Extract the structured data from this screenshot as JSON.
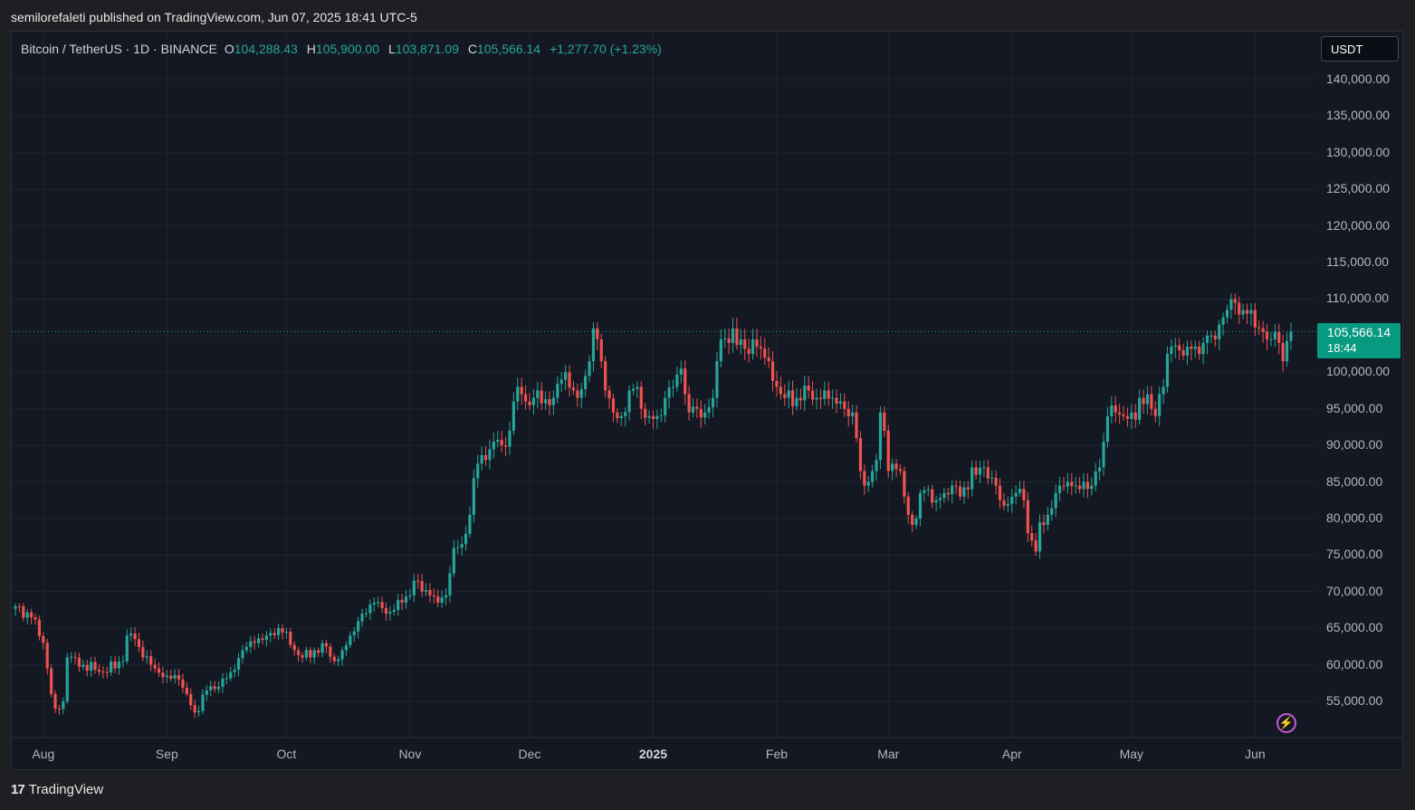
{
  "header": {
    "publisher_line": "semilorefaleti published on TradingView.com, Jun 07, 2025 18:41 UTC-5"
  },
  "legend": {
    "symbol": "Bitcoin / TetherUS · 1D · BINANCE",
    "open_label": "O",
    "open": "104,288.43",
    "high_label": "H",
    "high": "105,900.00",
    "low_label": "L",
    "low": "103,871.09",
    "close_label": "C",
    "close": "105,566.14",
    "change": "+1,277.70 (+1.23%)"
  },
  "currency_button": "USDT",
  "price_tag": {
    "price": "105,566.14",
    "countdown": "18:44"
  },
  "footer": {
    "logo_text": "TradingView",
    "logo_mark": "17"
  },
  "colors": {
    "up": "#26a69a",
    "down": "#ef5350",
    "background": "#141823",
    "grid": "#1f2430"
  },
  "icons": {
    "alert": "lightning-bolt-icon"
  },
  "chart_data": {
    "type": "candlestick",
    "title": "Bitcoin / TetherUS · 1D · BINANCE",
    "ylim": [
      51000,
      144000
    ],
    "grid": true,
    "y_ticks": [
      "140,000.00",
      "135,000.00",
      "130,000.00",
      "125,000.00",
      "120,000.00",
      "115,000.00",
      "110,000.00",
      "105,000.00",
      "100,000.00",
      "95,000.00",
      "90,000.00",
      "85,000.00",
      "80,000.00",
      "75,000.00",
      "70,000.00",
      "65,000.00",
      "60,000.00",
      "55,000.00"
    ],
    "y_tick_values": [
      140000,
      135000,
      130000,
      125000,
      120000,
      115000,
      110000,
      105000,
      100000,
      95000,
      90000,
      85000,
      80000,
      75000,
      70000,
      65000,
      60000,
      55000
    ],
    "x_ticks": [
      {
        "label": "Aug",
        "day": 7
      },
      {
        "label": "Sep",
        "day": 38
      },
      {
        "label": "Oct",
        "day": 68
      },
      {
        "label": "Nov",
        "day": 99
      },
      {
        "label": "Dec",
        "day": 129
      },
      {
        "label": "2025",
        "day": 160,
        "bold": true
      },
      {
        "label": "Feb",
        "day": 191
      },
      {
        "label": "Mar",
        "day": 219
      },
      {
        "label": "Apr",
        "day": 250
      },
      {
        "label": "May",
        "day": 280
      },
      {
        "label": "Jun",
        "day": 311
      }
    ],
    "last_price": 105566.14,
    "anchors": [
      [
        0,
        68000
      ],
      [
        4,
        66500
      ],
      [
        7,
        63000
      ],
      [
        9,
        56000
      ],
      [
        10,
        54000
      ],
      [
        12,
        55000
      ],
      [
        13,
        61000
      ],
      [
        17,
        60000
      ],
      [
        22,
        59000
      ],
      [
        27,
        60500
      ],
      [
        28,
        64000
      ],
      [
        30,
        63500
      ],
      [
        32,
        61000
      ],
      [
        35,
        59500
      ],
      [
        38,
        58500
      ],
      [
        41,
        58000
      ],
      [
        44,
        54500
      ],
      [
        45,
        53500
      ],
      [
        48,
        56500
      ],
      [
        51,
        57000
      ],
      [
        54,
        59000
      ],
      [
        57,
        62000
      ],
      [
        60,
        63000
      ],
      [
        63,
        64000
      ],
      [
        66,
        65000
      ],
      [
        68,
        64500
      ],
      [
        70,
        62000
      ],
      [
        72,
        61000
      ],
      [
        75,
        62000
      ],
      [
        78,
        62500
      ],
      [
        80,
        60500
      ],
      [
        82,
        62000
      ],
      [
        84,
        64000
      ],
      [
        87,
        67000
      ],
      [
        90,
        68500
      ],
      [
        93,
        67000
      ],
      [
        95,
        67500
      ],
      [
        97,
        68500
      ],
      [
        99,
        69500
      ],
      [
        100,
        71500
      ],
      [
        102,
        70000
      ],
      [
        104,
        69500
      ],
      [
        106,
        68500
      ],
      [
        108,
        69500
      ],
      [
        109,
        72500
      ],
      [
        110,
        76000
      ],
      [
        112,
        76500
      ],
      [
        114,
        80500
      ],
      [
        115,
        85500
      ],
      [
        116,
        87500
      ],
      [
        118,
        88000
      ],
      [
        120,
        90500
      ],
      [
        122,
        90000
      ],
      [
        124,
        92000
      ],
      [
        125,
        96000
      ],
      [
        126,
        98000
      ],
      [
        127,
        97000
      ],
      [
        128,
        96000
      ],
      [
        129,
        95500
      ],
      [
        130,
        96500
      ],
      [
        131,
        97500
      ],
      [
        134,
        95500
      ],
      [
        135,
        96500
      ],
      [
        137,
        99000
      ],
      [
        138,
        100000
      ],
      [
        140,
        97500
      ],
      [
        141,
        96500
      ],
      [
        143,
        99500
      ],
      [
        144,
        101500
      ],
      [
        145,
        106000
      ],
      [
        146,
        104500
      ],
      [
        147,
        101500
      ],
      [
        148,
        97500
      ],
      [
        150,
        94500
      ],
      [
        152,
        94000
      ],
      [
        154,
        97500
      ],
      [
        156,
        98000
      ],
      [
        157,
        95000
      ],
      [
        159,
        94000
      ],
      [
        161,
        94000
      ],
      [
        163,
        96500
      ],
      [
        165,
        98000
      ],
      [
        167,
        100500
      ],
      [
        168,
        97000
      ],
      [
        169,
        94500
      ],
      [
        171,
        95000
      ],
      [
        173,
        94500
      ],
      [
        175,
        96500
      ],
      [
        176,
        101500
      ],
      [
        177,
        104500
      ],
      [
        179,
        104000
      ],
      [
        180,
        106000
      ],
      [
        182,
        104500
      ],
      [
        184,
        102500
      ],
      [
        185,
        104500
      ],
      [
        186,
        103500
      ],
      [
        188,
        102000
      ],
      [
        189,
        101500
      ],
      [
        191,
        98000
      ],
      [
        192,
        97000
      ],
      [
        193,
        96500
      ],
      [
        196,
        96500
      ],
      [
        199,
        97500
      ],
      [
        201,
        96500
      ],
      [
        203,
        97500
      ],
      [
        205,
        96500
      ],
      [
        207,
        96000
      ],
      [
        208,
        95000
      ],
      [
        210,
        94500
      ],
      [
        211,
        91000
      ],
      [
        212,
        86500
      ],
      [
        213,
        84500
      ],
      [
        214,
        85000
      ],
      [
        216,
        88000
      ],
      [
        217,
        94500
      ],
      [
        218,
        92000
      ],
      [
        219,
        86500
      ],
      [
        220,
        87500
      ],
      [
        222,
        86500
      ],
      [
        223,
        83000
      ],
      [
        224,
        80500
      ],
      [
        226,
        80000
      ],
      [
        227,
        83500
      ],
      [
        229,
        84000
      ],
      [
        231,
        82500
      ],
      [
        233,
        83500
      ],
      [
        235,
        84500
      ],
      [
        237,
        83000
      ],
      [
        239,
        84000
      ],
      [
        240,
        87000
      ],
      [
        241,
        86000
      ],
      [
        243,
        87000
      ],
      [
        244,
        85500
      ],
      [
        246,
        84500
      ],
      [
        247,
        82500
      ],
      [
        249,
        82000
      ],
      [
        251,
        83500
      ],
      [
        253,
        82500
      ],
      [
        254,
        78000
      ],
      [
        255,
        77000
      ],
      [
        256,
        75500
      ],
      [
        257,
        79500
      ],
      [
        259,
        80500
      ],
      [
        261,
        83500
      ],
      [
        262,
        84500
      ],
      [
        264,
        85000
      ],
      [
        266,
        84500
      ],
      [
        268,
        85000
      ],
      [
        270,
        84500
      ],
      [
        272,
        87000
      ],
      [
        273,
        90500
      ],
      [
        274,
        94000
      ],
      [
        276,
        94500
      ],
      [
        278,
        94000
      ],
      [
        280,
        94500
      ],
      [
        281,
        93500
      ],
      [
        282,
        96500
      ],
      [
        284,
        97000
      ],
      [
        285,
        95000
      ],
      [
        286,
        94000
      ],
      [
        287,
        97000
      ],
      [
        288,
        98000
      ],
      [
        289,
        102500
      ],
      [
        290,
        103500
      ],
      [
        292,
        103000
      ],
      [
        294,
        103500
      ],
      [
        296,
        103500
      ],
      [
        298,
        104000
      ],
      [
        300,
        105000
      ],
      [
        301,
        104500
      ],
      [
        302,
        106500
      ],
      [
        303,
        107500
      ],
      [
        305,
        110000
      ],
      [
        306,
        109500
      ],
      [
        308,
        108500
      ],
      [
        309,
        108000
      ],
      [
        310,
        108500
      ],
      [
        312,
        106000
      ],
      [
        313,
        105500
      ],
      [
        314,
        104500
      ],
      [
        315,
        104500
      ],
      [
        316,
        105500
      ],
      [
        317,
        104000
      ],
      [
        318,
        101500
      ],
      [
        319,
        104288.43
      ],
      [
        320,
        105566.14
      ]
    ]
  }
}
